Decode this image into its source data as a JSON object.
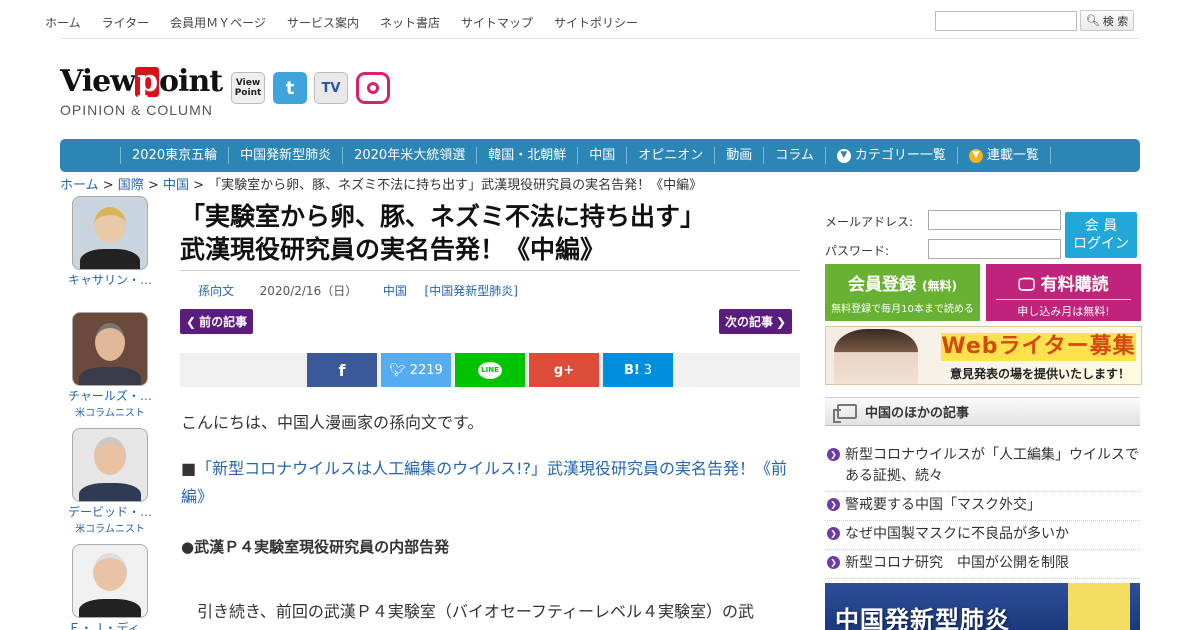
{
  "topnav": {
    "items": [
      "ホーム",
      "ライター",
      "会員用ＭＹページ",
      "サービス案内",
      "ネット書店",
      "サイトマップ",
      "サイトポリシー"
    ],
    "search_button": "検 索"
  },
  "logo": {
    "brand_prefix": "View",
    "brand_p": "p",
    "brand_suffix": "oint",
    "subtitle": "OPINION & COLUMN"
  },
  "social": {
    "vp": "View Point",
    "twitter": "t",
    "tv": "TV"
  },
  "categories": {
    "items": [
      "2020東京五輪",
      "中国発新型肺炎",
      "2020年米大統領選",
      "韓国・北朝鮮",
      "中国",
      "オピニオン",
      "動画",
      "コラム"
    ],
    "category_list": "カテゴリー一覧",
    "series_list": "連載一覧"
  },
  "breadcrumb": {
    "home": "ホーム",
    "sep1": " > ",
    "intl": "国際",
    "sep2": " > ",
    "china": "中国",
    "sep3": " > ",
    "current": "「実験室から卵、豚、ネズミ不法に持ち出す」武漢現役研究員の実名告発！《中編》"
  },
  "columnists": [
    {
      "name": "キャサリン・…",
      "role": ""
    },
    {
      "name": "チャールズ・…",
      "role": "米コラムニスト"
    },
    {
      "name": "デービッド・…",
      "role": "米コラムニスト"
    },
    {
      "name": "Ｅ・Ｊ・ディ…",
      "role": ""
    }
  ],
  "article": {
    "title_line1": "「実験室から卵、豚、ネズミ不法に持ち出す」",
    "title_line2": "武漢現役研究員の実名告発！《中編》",
    "author": "孫向文",
    "date": "2020/2/16（日）",
    "category": "中国",
    "tag": "[中国発新型肺炎]",
    "prev_label": "前の記事",
    "next_label": "次の記事",
    "share": {
      "facebook": "f",
      "twitter_count": "2219",
      "line": "LINE",
      "gplus": "g+",
      "hatena": "B!",
      "hatena_count": "3"
    },
    "intro": "こんにちは、中国人漫画家の孫向文です。",
    "link_bullet": "■",
    "link_text": "「新型コロナウイルスは人工編集のウイルス!?」武漢現役研究員の実名告発！《前編》",
    "subheading": "●武漢Ｐ４実験室現役研究員の内部告発",
    "body_start": "　引き続き、前回の武漢Ｐ４実験室（バイオセーフティーレベル４実験室）の武"
  },
  "sidebar": {
    "email_label": "メールアドレス:",
    "password_label": "パスワード:",
    "login_line1": "会 員",
    "login_line2": "ログイン",
    "register_big": "会員登録",
    "register_free": "(無料)",
    "register_sub": "無料登録で毎月10本まで読める",
    "subscribe_big": "有料購読",
    "subscribe_sub": "申し込み月は無料!",
    "banner_title": "Webライター募集",
    "banner_sub": "意見発表の場を提供いたします！",
    "more_heading": "中国のほかの記事",
    "more_articles": [
      "新型コロナウイルスが「人工編集」ウイルスである証拠、続々",
      "警戒要する中国「マスク外交」",
      "なぜ中国製マスクに不良品が多いか",
      "新型コロナ研究　中国が公開を制限"
    ],
    "bottom_banner": "中国発新型肺炎"
  }
}
